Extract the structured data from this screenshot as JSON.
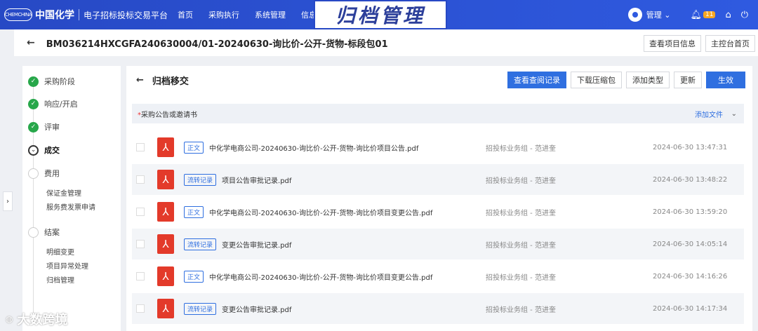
{
  "topbar": {
    "logo_mark": "CHEMCHINA",
    "logo_text": "中国化学",
    "platform": "电子招标投标交易平台",
    "nav": [
      "首页",
      "采购执行",
      "系统管理",
      "信息"
    ],
    "user_name": "管理",
    "notification_count": "11"
  },
  "banner": {
    "title": "归档管理"
  },
  "header": {
    "bid_title": "BM036214HXCGFA240630004/01-20240630-询比价-公开-货物-标段包01",
    "buttons": [
      "查看项目信息",
      "主控台首页"
    ]
  },
  "sidebar": {
    "steps": [
      {
        "label": "采购阶段"
      },
      {
        "label": "响应/开启"
      },
      {
        "label": "评审"
      },
      {
        "label": "成交"
      },
      {
        "label": "费用"
      },
      {
        "label": "结案"
      }
    ],
    "fee_subs": [
      "保证金管理",
      "服务费发票申请"
    ],
    "close_subs": [
      "明细变更",
      "项目异常处理",
      "归档管理"
    ]
  },
  "main": {
    "title": "归档移交",
    "buttons": {
      "view_records": "查看查阅记录",
      "download_zip": "下载压缩包",
      "add_type": "添加类型",
      "update": "更新",
      "effective": "生效"
    },
    "section": {
      "required_mark": "*",
      "title": "采购公告或邀请书",
      "add_file": "添加文件"
    },
    "files": [
      {
        "tag": "正文",
        "name": "中化学电商公司-20240630-询比价-公开-货物-询比价项目公告.pdf",
        "uploader": "招投标业务组 - 范进奎",
        "time": "2024-06-30 13:47:31"
      },
      {
        "tag": "流转记录",
        "name": "项目公告审批记录.pdf",
        "uploader": "招投标业务组 - 范进奎",
        "time": "2024-06-30 13:48:22"
      },
      {
        "tag": "正文",
        "name": "中化学电商公司-20240630-询比价-公开-货物-询比价项目变更公告.pdf",
        "uploader": "招投标业务组 - 范进奎",
        "time": "2024-06-30 13:59:20"
      },
      {
        "tag": "流转记录",
        "name": "变更公告审批记录.pdf",
        "uploader": "招投标业务组 - 范进奎",
        "time": "2024-06-30 14:05:14"
      },
      {
        "tag": "正文",
        "name": "中化学电商公司-20240630-询比价-公开-货物-询比价项目变更公告.pdf",
        "uploader": "招投标业务组 - 范进奎",
        "time": "2024-06-30 14:16:26"
      },
      {
        "tag": "流转记录",
        "name": "变更公告审批记录.pdf",
        "uploader": "招投标业务组 - 范进奎",
        "time": "2024-06-30 14:17:34"
      }
    ]
  },
  "watermark": {
    "text": "大数跨境"
  }
}
